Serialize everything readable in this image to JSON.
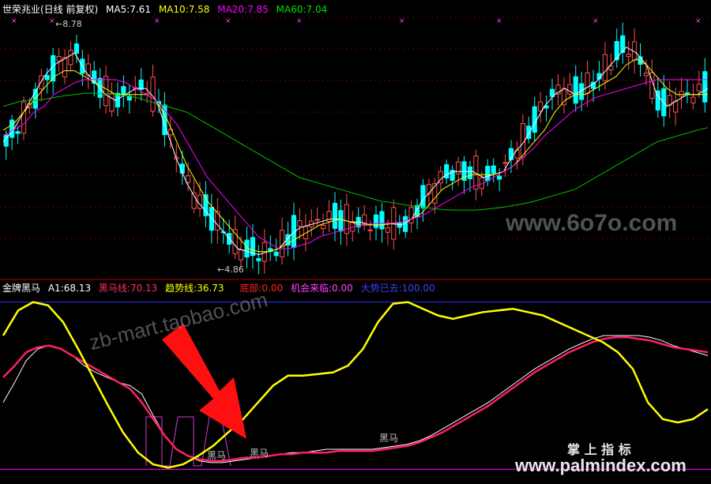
{
  "top_legend": {
    "name": "世荣兆业(日线 前复权)",
    "ma5": "MA5:7.61",
    "ma10": "MA10:7.58",
    "ma20": "MA20:7.85",
    "ma60": "MA60:7.04"
  },
  "bottom_legend": {
    "name": "金牌黑马",
    "a1": "A1:68.13",
    "heima": "黑马线:70.13",
    "trend": "趋势线:36.73",
    "bottom": "底部:0.00",
    "chance": "机会来临:0.00",
    "gone": "大势已去:100.00"
  },
  "annotations": {
    "high": "8.78",
    "low": "4.86",
    "heima_1": "黑马",
    "heima_2": "黑马",
    "heima_3": "黑马"
  },
  "watermarks": {
    "site1": "www.6o7o.com",
    "site2": "zb-mart.taobao.com",
    "brand": "掌 上 指 标",
    "site3": "www.palmindex.com"
  },
  "colors": {
    "ma5": "#ffffff",
    "ma10": "#ffff00",
    "ma20": "#ff00ff",
    "ma60": "#00c000",
    "up": "#ff5050",
    "down": "#00ffff",
    "heima_line": "#ff2060",
    "trend_line": "#ffff00",
    "a1_line": "#ffffff",
    "bottom": "#ff0000",
    "chance": "#ff00ff",
    "gone": "#3030ff"
  },
  "chart_data": [
    {
      "type": "line",
      "ylim": [
        4.6,
        8.9
      ],
      "x_count": 120,
      "price_high_label": 8.78,
      "price_low_label": 4.86,
      "series": [
        {
          "name": "MA5",
          "values": [
            6.8,
            7.0,
            7.3,
            7.6,
            7.9,
            8.1,
            8.2,
            8.3,
            8.0,
            7.8,
            7.6,
            7.5,
            7.6,
            7.7,
            7.7,
            7.5,
            7.0,
            6.5,
            6.1,
            5.8,
            5.6,
            5.4,
            5.2,
            5.0,
            4.95,
            4.9,
            4.95,
            5.0,
            5.2,
            5.35,
            5.4,
            5.45,
            5.5,
            5.5,
            5.45,
            5.45,
            5.4,
            5.4,
            5.42,
            5.4,
            5.5,
            5.8,
            6.0,
            6.2,
            6.3,
            6.3,
            6.3,
            6.2,
            6.25,
            6.3,
            6.6,
            6.8,
            7.1,
            7.4,
            7.6,
            7.7,
            7.6,
            7.7,
            7.8,
            8.0,
            8.2,
            8.4,
            8.3,
            8.1,
            7.6,
            7.4,
            7.5,
            7.6,
            7.6,
            7.7
          ]
        },
        {
          "name": "MA10",
          "values": [
            7.0,
            7.1,
            7.3,
            7.5,
            7.7,
            7.9,
            8.0,
            8.0,
            7.9,
            7.8,
            7.7,
            7.6,
            7.6,
            7.6,
            7.6,
            7.5,
            7.2,
            6.8,
            6.4,
            6.1,
            5.8,
            5.6,
            5.4,
            5.2,
            5.0,
            4.95,
            4.95,
            5.0,
            5.1,
            5.2,
            5.3,
            5.4,
            5.45,
            5.5,
            5.45,
            5.4,
            5.4,
            5.4,
            5.42,
            5.45,
            5.5,
            5.6,
            5.8,
            6.0,
            6.1,
            6.2,
            6.25,
            6.25,
            6.25,
            6.3,
            6.4,
            6.6,
            6.8,
            7.0,
            7.3,
            7.5,
            7.6,
            7.6,
            7.7,
            7.8,
            7.9,
            8.1,
            8.2,
            8.1,
            7.9,
            7.7,
            7.6,
            7.6,
            7.6,
            7.6
          ]
        },
        {
          "name": "MA20",
          "values": [
            6.9,
            7.0,
            7.1,
            7.3,
            7.4,
            7.6,
            7.7,
            7.8,
            7.85,
            7.85,
            7.85,
            7.85,
            7.8,
            7.7,
            7.6,
            7.5,
            7.3,
            7.1,
            6.8,
            6.5,
            6.2,
            6.0,
            5.8,
            5.6,
            5.4,
            5.2,
            5.1,
            5.0,
            5.0,
            5.05,
            5.1,
            5.2,
            5.25,
            5.3,
            5.35,
            5.4,
            5.42,
            5.43,
            5.43,
            5.45,
            5.5,
            5.55,
            5.65,
            5.75,
            5.85,
            5.95,
            6.05,
            6.1,
            6.2,
            6.3,
            6.4,
            6.55,
            6.7,
            6.9,
            7.05,
            7.2,
            7.35,
            7.45,
            7.55,
            7.6,
            7.65,
            7.7,
            7.75,
            7.8,
            7.85,
            7.85,
            7.85,
            7.85,
            7.85,
            7.85
          ]
        },
        {
          "name": "MA60",
          "values": [
            7.4,
            7.45,
            7.5,
            7.5,
            7.52,
            7.55,
            7.58,
            7.6,
            7.62,
            7.62,
            7.62,
            7.6,
            7.58,
            7.55,
            7.5,
            7.45,
            7.4,
            7.35,
            7.3,
            7.2,
            7.1,
            7.0,
            6.9,
            6.8,
            6.7,
            6.6,
            6.5,
            6.4,
            6.3,
            6.2,
            6.15,
            6.1,
            6.05,
            6.0,
            5.95,
            5.9,
            5.85,
            5.8,
            5.78,
            5.75,
            5.72,
            5.7,
            5.68,
            5.66,
            5.65,
            5.65,
            5.65,
            5.66,
            5.68,
            5.7,
            5.73,
            5.76,
            5.8,
            5.85,
            5.9,
            5.95,
            6.0,
            6.1,
            6.2,
            6.3,
            6.4,
            6.5,
            6.6,
            6.7,
            6.8,
            6.85,
            6.9,
            6.95,
            7.0,
            7.04
          ]
        }
      ]
    },
    {
      "type": "line",
      "ylim": [
        -5,
        105
      ],
      "levels": {
        "bottom": 0,
        "chance": 0,
        "gone": 100
      },
      "series": [
        {
          "name": "A1",
          "values": [
            40,
            52,
            65,
            72,
            74,
            72,
            68,
            62,
            58,
            55,
            52,
            50,
            45,
            32,
            20,
            12,
            8,
            5,
            4,
            4,
            5,
            6,
            7,
            8,
            9,
            10,
            10,
            11,
            12,
            12,
            12,
            12,
            12,
            13,
            14,
            15,
            17,
            20,
            24,
            28,
            32,
            36,
            40,
            45,
            50,
            55,
            60,
            64,
            68,
            72,
            75,
            78,
            80,
            80,
            80,
            80,
            79,
            77,
            74,
            72,
            70,
            68
          ]
        },
        {
          "name": "黑马线",
          "values": [
            55,
            62,
            70,
            73,
            74,
            72,
            68,
            64,
            60,
            56,
            52,
            48,
            40,
            30,
            20,
            12,
            8,
            6,
            5,
            5,
            6,
            7,
            7,
            8,
            9,
            9,
            10,
            10,
            10,
            11,
            11,
            11,
            11,
            12,
            13,
            14,
            16,
            19,
            22,
            26,
            30,
            34,
            38,
            43,
            48,
            53,
            58,
            62,
            66,
            70,
            73,
            76,
            78,
            79,
            79,
            78,
            77,
            75,
            73,
            72,
            71,
            70
          ]
        },
        {
          "name": "趋势线",
          "values": [
            80,
            95,
            100,
            98,
            88,
            72,
            55,
            38,
            22,
            10,
            3,
            1,
            3,
            8,
            14,
            22,
            30,
            40,
            50,
            56,
            56,
            57,
            58,
            62,
            72,
            88,
            99,
            100,
            96,
            92,
            90,
            92,
            94,
            95,
            96,
            94,
            92,
            88,
            84,
            80,
            76,
            70,
            60,
            40,
            30,
            28,
            30,
            36
          ]
        }
      ]
    }
  ]
}
